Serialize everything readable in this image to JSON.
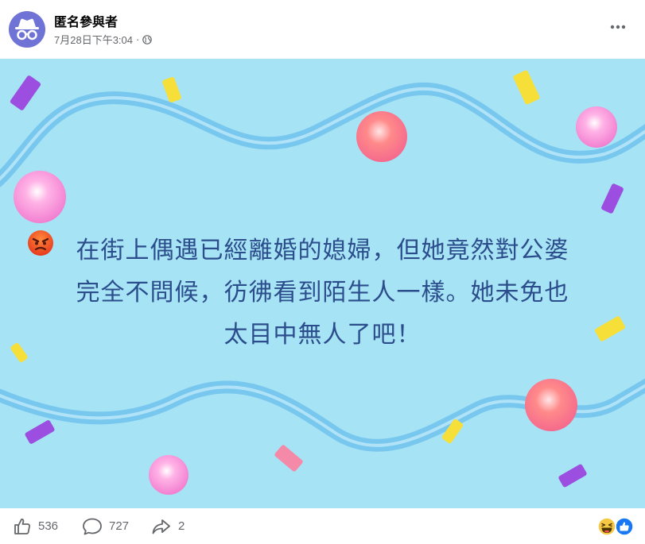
{
  "post": {
    "author": "匿名參與者",
    "timestamp": "7月28日下午3:04",
    "separator": "·",
    "privacy_icon": "globe-icon",
    "more_icon": "ellipsis-icon",
    "text_lines": [
      "在街上偶遇已經離婚的媳婦，但她竟然對公婆",
      "完全不問候，彷彿看到陌生人一樣。她未免也",
      "太目中無人了吧！"
    ],
    "emoji": "angry-face-emoji",
    "background_color": "#a6e3f5",
    "text_color": "#2c4d8c"
  },
  "footer": {
    "likes": "536",
    "comments": "727",
    "shares": "2",
    "reaction_icons": [
      "haha-reaction-icon",
      "like-reaction-icon"
    ]
  }
}
